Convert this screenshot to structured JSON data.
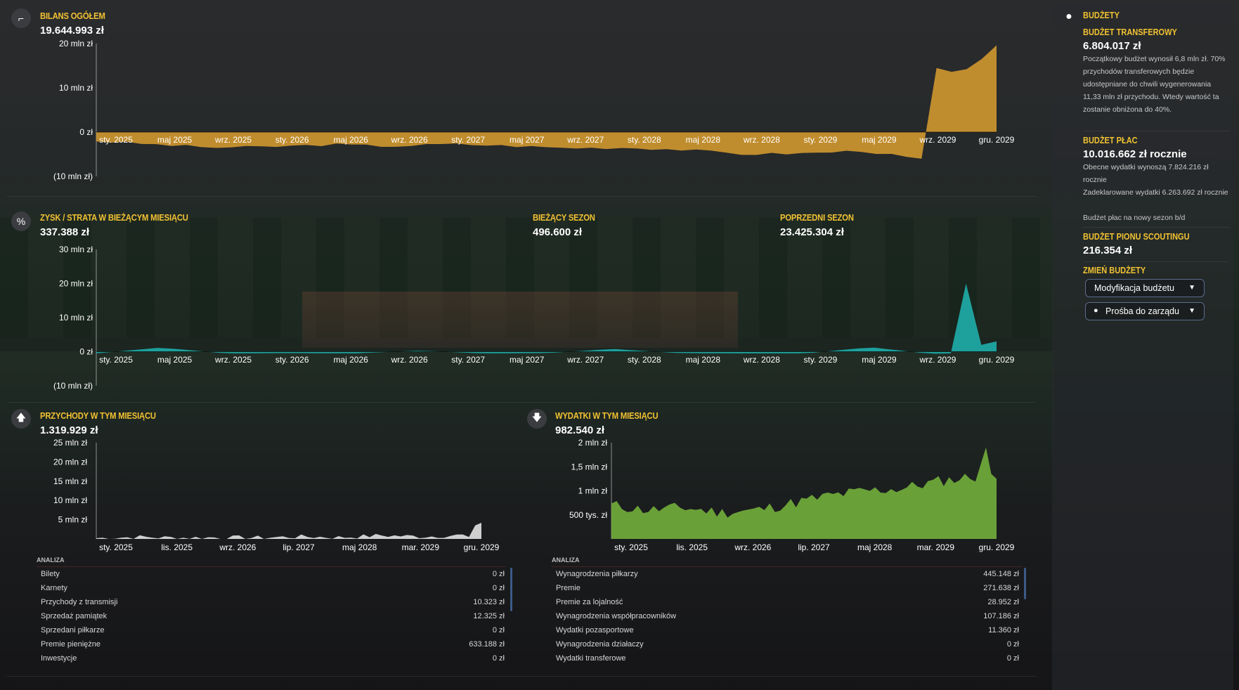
{
  "balance": {
    "title": "BILANS OGÓŁEM",
    "value": "19.644.993 zł",
    "y_ticks": [
      "20 mln zł",
      "10 mln zł",
      "0 zł",
      "(10 mln zł)"
    ],
    "x_ticks": [
      "sty. 2025",
      "maj 2025",
      "wrz. 2025",
      "sty. 2026",
      "maj 2026",
      "wrz. 2026",
      "sty. 2027",
      "maj 2027",
      "wrz. 2027",
      "sty. 2028",
      "maj 2028",
      "wrz. 2028",
      "sty. 2029",
      "maj 2029",
      "wrz. 2029",
      "gru. 2029"
    ]
  },
  "profit": {
    "title": "ZYSK / STRATA W BIEŻĄCYM MIESIĄCU",
    "value": "337.388 zł",
    "current_season_title": "BIEŻĄCY SEZON",
    "current_season_value": "496.600 zł",
    "prev_season_title": "POPRZEDNI SEZON",
    "prev_season_value": "23.425.304 zł",
    "y_ticks": [
      "30 mln zł",
      "20 mln zł",
      "10 mln zł",
      "0 zł",
      "(10 mln zł)"
    ],
    "x_ticks": [
      "sty. 2025",
      "maj 2025",
      "wrz. 2025",
      "sty. 2026",
      "maj 2026",
      "wrz. 2026",
      "sty. 2027",
      "maj 2027",
      "wrz. 2027",
      "sty. 2028",
      "maj 2028",
      "wrz. 2028",
      "sty. 2029",
      "maj 2029",
      "wrz. 2029",
      "gru. 2029"
    ]
  },
  "income": {
    "title": "PRZYCHODY W TYM MIESIĄCU",
    "value": "1.319.929 zł",
    "y_ticks": [
      "25 mln zł",
      "20 mln zł",
      "15 mln zł",
      "10 mln zł",
      "5 mln zł"
    ],
    "x_ticks": [
      "sty. 2025",
      "lis. 2025",
      "wrz. 2026",
      "lip. 2027",
      "maj 2028",
      "mar. 2029",
      "gru. 2029"
    ],
    "analysis_title": "ANALIZA",
    "rows": [
      {
        "label": "Bilety",
        "value": "0 zł"
      },
      {
        "label": "Karnety",
        "value": "0 zł"
      },
      {
        "label": "Przychody z transmisji",
        "value": "10.323 zł"
      },
      {
        "label": "Sprzedaż pamiątek",
        "value": "12.325 zł"
      },
      {
        "label": "Sprzedani piłkarze",
        "value": "0 zł"
      },
      {
        "label": "Premie pieniężne",
        "value": "633.188 zł"
      },
      {
        "label": "Inwestycje",
        "value": "0 zł"
      }
    ]
  },
  "expenses": {
    "title": "WYDATKI W TYM MIESIĄCU",
    "value": "982.540 zł",
    "y_ticks": [
      "2 mln zł",
      "1,5 mln zł",
      "1 mln zł",
      "500 tys. zł"
    ],
    "x_ticks": [
      "sty. 2025",
      "lis. 2025",
      "wrz. 2026",
      "lip. 2027",
      "maj 2028",
      "mar. 2029",
      "gru. 2029"
    ],
    "analysis_title": "ANALIZA",
    "rows": [
      {
        "label": "Wynagrodzenia piłkarzy",
        "value": "445.148 zł"
      },
      {
        "label": "Premie",
        "value": "271.638 zł"
      },
      {
        "label": "Premie za lojalność",
        "value": "28.952 zł"
      },
      {
        "label": "Wynagrodzenia współpracowników",
        "value": "107.186 zł"
      },
      {
        "label": "Wydatki pozasportowe",
        "value": "11.360 zł"
      },
      {
        "label": "Wynagrodzenia działaczy",
        "value": "0 zł"
      },
      {
        "label": "Wydatki transferowe",
        "value": "0 zł"
      }
    ]
  },
  "sidebar": {
    "title": "BUDŻETY",
    "transfer_title": "BUDŻET TRANSFEROWY",
    "transfer_value": "6.804.017 zł",
    "transfer_text": "Początkowy budżet wynosił 6,8 mln zł. 70% przychodów transferowych będzie udostępniane do chwili wygenerowania 11,33 mln zł przychodu. Wtedy wartość ta zostanie obniżona do 40%.",
    "wage_title": "BUDŻET PŁAC",
    "wage_value": "10.016.662 zł rocznie",
    "wage_text1": "Obecne wydatki wynoszą 7.824.216 zł rocznie",
    "wage_text2": "Zadeklarowane wydatki 6.263.692 zł rocznie",
    "wage_text3": "Budżet płac na nowy sezon b/d",
    "scout_title": "BUDŻET PIONU SCOUTINGU",
    "scout_value": "216.354 zł",
    "change_title": "ZMIEŃ BUDŻETY",
    "dropdown1": "Modyfikacja budżetu",
    "dropdown2": "Prośba do zarządu"
  },
  "colors": {
    "balance": "#c8922e",
    "profit": "#1fa6a3",
    "income": "#d9d9d9",
    "expenses": "#6fa83a",
    "accent": "#f1c232"
  },
  "chart_data": [
    {
      "type": "area",
      "title": "BILANS OGÓŁEM",
      "ylim": [
        -10,
        20
      ],
      "unit": "mln zł",
      "x": [
        "sty. 2025",
        "maj 2025",
        "wrz. 2025",
        "sty. 2026",
        "maj 2026",
        "wrz. 2026",
        "sty. 2027",
        "maj 2027",
        "wrz. 2027",
        "sty. 2028",
        "maj 2028",
        "wrz. 2028",
        "sty. 2029",
        "maj 2029",
        "wrz. 2029",
        "gru. 2029"
      ],
      "values": [
        -2,
        -2.8,
        -3.5,
        -3.3,
        -2.8,
        -3.2,
        -2.7,
        -3.1,
        -3.6,
        -3.5,
        -4,
        -5,
        -4.8,
        -4.2,
        -6.2,
        19.6
      ]
    },
    {
      "type": "area",
      "title": "ZYSK / STRATA W BIEŻĄCYM MIESIĄCU",
      "ylim": [
        -10,
        30
      ],
      "unit": "mln zł",
      "x": [
        "sty. 2025",
        "maj 2025",
        "wrz. 2025",
        "sty. 2026",
        "maj 2026",
        "wrz. 2026",
        "sty. 2027",
        "maj 2027",
        "wrz. 2027",
        "sty. 2028",
        "maj 2028",
        "wrz. 2028",
        "sty. 2029",
        "maj 2029",
        "wrz. 2029",
        "gru. 2029"
      ],
      "values": [
        -0.5,
        1.2,
        -0.5,
        -0.4,
        -0.5,
        0.3,
        -0.5,
        -0.4,
        0.8,
        -0.4,
        -0.5,
        -0.5,
        1.3,
        -0.8,
        20,
        3
      ]
    },
    {
      "type": "area",
      "title": "PRZYCHODY W TYM MIESIĄCU",
      "ylim": [
        0,
        25
      ],
      "unit": "mln zł",
      "x": [
        "sty. 2025",
        "lis. 2025",
        "wrz. 2026",
        "lip. 2027",
        "maj 2028",
        "mar. 2029",
        "gru. 2029"
      ],
      "values": [
        0.3,
        0.5,
        0.4,
        0.6,
        0.8,
        1.2,
        4.2
      ]
    },
    {
      "type": "area",
      "title": "WYDATKI W TYM MIESIĄCU",
      "ylim": [
        0,
        2
      ],
      "unit": "mln zł",
      "x": [
        "sty. 2025",
        "lis. 2025",
        "wrz. 2026",
        "lip. 2027",
        "maj 2028",
        "mar. 2029",
        "gru. 2029"
      ],
      "values": [
        0.7,
        0.6,
        0.55,
        0.65,
        0.8,
        1.2,
        1.3
      ]
    }
  ]
}
